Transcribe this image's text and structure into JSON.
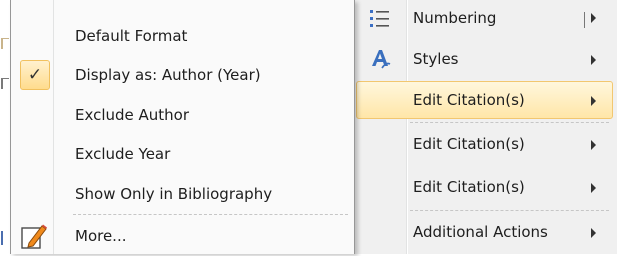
{
  "parent_menu": {
    "items": [
      {
        "label": "Numbering",
        "icon": "numbered-list-icon",
        "has_submenu": true,
        "highlighted": false
      },
      {
        "label": "Styles",
        "icon": "styles-icon",
        "has_submenu": true,
        "highlighted": false
      },
      {
        "label": "Edit Citation(s)",
        "icon": "",
        "has_submenu": true,
        "highlighted": true
      },
      {
        "label": "Edit Citation(s)",
        "icon": "",
        "has_submenu": true,
        "highlighted": false
      },
      {
        "label": "Edit Citation(s)",
        "icon": "",
        "has_submenu": true,
        "highlighted": false
      },
      {
        "label": "Additional Actions",
        "icon": "",
        "has_submenu": true,
        "highlighted": false
      }
    ],
    "highlight_color": "#ffe6a8"
  },
  "submenu": {
    "items": [
      {
        "label": "Default Format",
        "checked": false
      },
      {
        "label": "Display as: Author (Year)",
        "checked": true,
        "check_glyph": "✓"
      },
      {
        "label": "Exclude Author",
        "checked": false
      },
      {
        "label": "Exclude Year",
        "checked": false
      },
      {
        "label": "Show Only in Bibliography",
        "checked": false
      },
      {
        "label": "More...",
        "icon": "edit-pencil-icon"
      }
    ]
  }
}
